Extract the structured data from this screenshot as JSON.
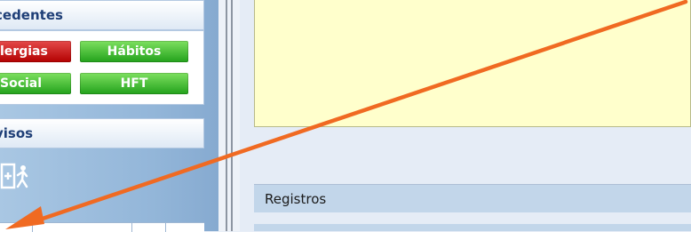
{
  "sidebar": {
    "antecedentes": {
      "title": "cedentes",
      "buttons": [
        {
          "label": "lergias",
          "color": "#c40000"
        },
        {
          "label": "Hábitos",
          "color": "#2aa81f"
        },
        {
          "label": "Social",
          "color": "#2aa81f"
        },
        {
          "label": "HFT",
          "color": "#2aa81f"
        }
      ]
    },
    "avisos": {
      "title": "visos",
      "icon": "door-exit-icon"
    }
  },
  "main": {
    "registros_label": "Registros"
  },
  "annotation": {
    "arrow_color": "#f06a22"
  }
}
